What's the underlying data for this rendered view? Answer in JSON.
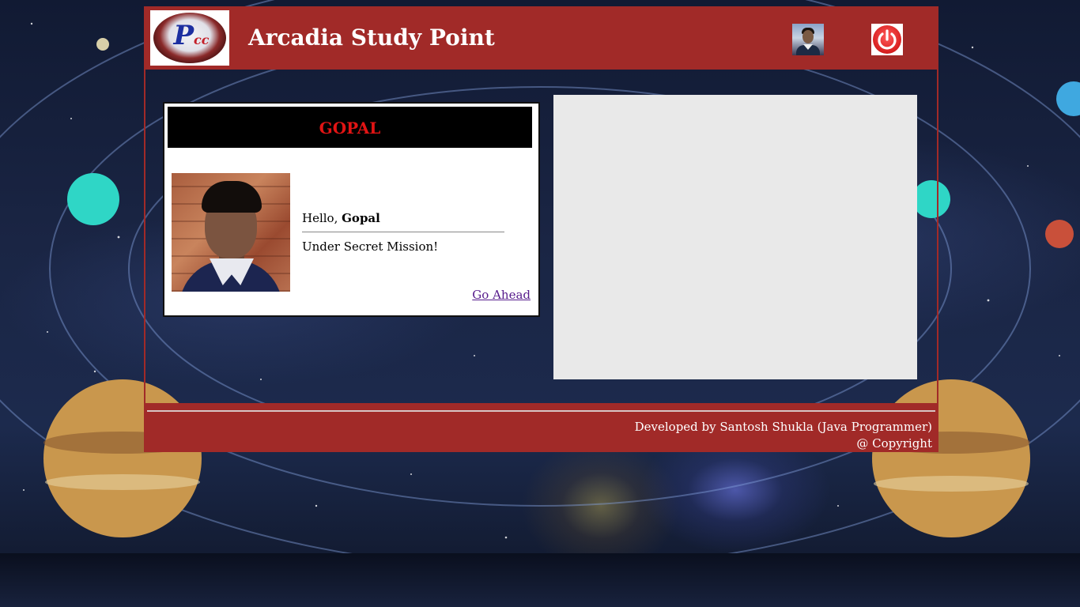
{
  "header": {
    "logo_text": "P",
    "logo_subtext": "cc",
    "site_title": "Arcadia Study Point",
    "user_avatar_icon": "user-avatar-icon",
    "power_icon": "power-icon"
  },
  "profile_card": {
    "name_heading": "GOPAL",
    "greeting_prefix": "Hello, ",
    "greeting_name": "Gopal",
    "status": "Under Secret Mission!",
    "go_ahead_link": "Go Ahead"
  },
  "footer": {
    "developer_credit": "Developed by Santosh Shukla (Java Programmer)",
    "copyright": "@ Copyright"
  },
  "colors": {
    "brand_red": "#a12a28",
    "heading_red": "#e11414",
    "panel_gray": "#e9e9e9"
  }
}
